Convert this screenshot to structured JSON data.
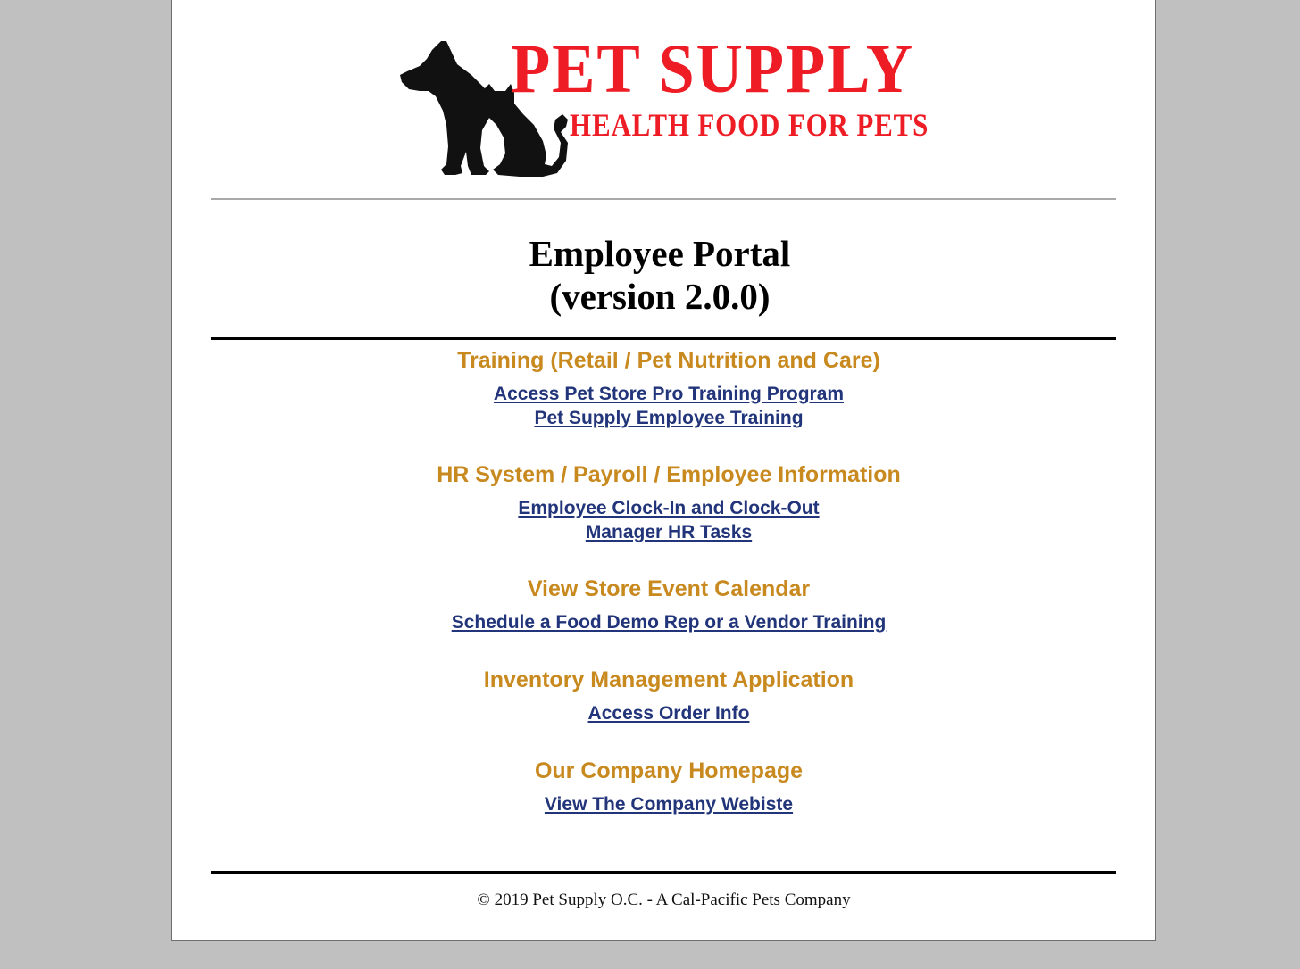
{
  "logo": {
    "title": "PET SUPPLY",
    "subtitle": "HEALTH FOOD FOR PETS",
    "icon": "dog-and-cat-silhouette-icon",
    "color": "#ee1c25"
  },
  "portal": {
    "title": "Employee Portal",
    "version": "(version 2.0.0)"
  },
  "sections": [
    {
      "heading": "Training (Retail / Pet Nutrition and Care)",
      "links": [
        "Access Pet Store Pro Training Program",
        "Pet Supply Employee Training"
      ]
    },
    {
      "heading": "HR System / Payroll / Employee Information",
      "links": [
        "Employee Clock-In and Clock-Out",
        "Manager HR Tasks"
      ]
    },
    {
      "heading": "View Store Event Calendar",
      "links": [
        "Schedule a Food Demo Rep or a Vendor Training"
      ]
    },
    {
      "heading": "Inventory Management Application",
      "links": [
        "Access Order Info"
      ]
    },
    {
      "heading": "Our Company Homepage",
      "links": [
        "View The Company Webiste"
      ]
    }
  ],
  "footer": "© 2019 Pet Supply O.C. - A Cal-Pacific Pets Company",
  "colors": {
    "heading": "#c8891f",
    "link": "#22357a",
    "background": "#c0c0c0"
  }
}
